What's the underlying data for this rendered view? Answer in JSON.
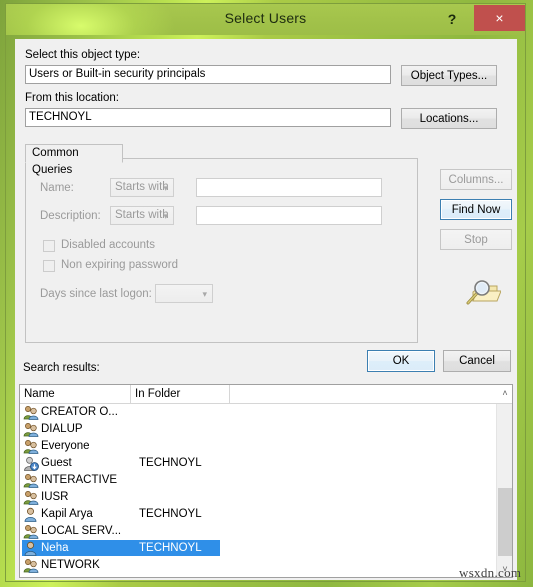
{
  "window": {
    "title": "Select Users",
    "help_label": "?",
    "close_label": "×"
  },
  "form": {
    "object_type_label": "Select this object type:",
    "object_type_value": "Users or Built-in security principals",
    "object_types_button": "Object Types...",
    "location_label": "From this location:",
    "location_value": "TECHNOYL",
    "locations_button": "Locations..."
  },
  "common_queries": {
    "tab_label": "Common Queries",
    "name_label": "Name:",
    "name_operator": "Starts with",
    "name_value": "",
    "description_label": "Description:",
    "description_operator": "Starts with",
    "description_value": "",
    "disabled_accounts_label": "Disabled accounts",
    "non_expiring_password_label": "Non expiring password",
    "days_since_logon_label": "Days since last logon:",
    "days_since_logon_value": ""
  },
  "side_buttons": {
    "columns": "Columns...",
    "find_now": "Find Now",
    "stop": "Stop"
  },
  "footer": {
    "ok": "OK",
    "cancel": "Cancel",
    "search_results_label": "Search results:"
  },
  "results": {
    "columns": [
      "Name",
      "In Folder",
      ""
    ],
    "rows": [
      {
        "name": "CREATOR O...",
        "folder": "",
        "icon": "group-icon",
        "selected": false
      },
      {
        "name": "DIALUP",
        "folder": "",
        "icon": "group-icon",
        "selected": false
      },
      {
        "name": "Everyone",
        "folder": "",
        "icon": "group-icon",
        "selected": false
      },
      {
        "name": "Guest",
        "folder": "TECHNOYL",
        "icon": "user-disabled-icon",
        "selected": false
      },
      {
        "name": "INTERACTIVE",
        "folder": "",
        "icon": "group-icon",
        "selected": false
      },
      {
        "name": "IUSR",
        "folder": "",
        "icon": "group-icon",
        "selected": false
      },
      {
        "name": "Kapil Arya",
        "folder": "TECHNOYL",
        "icon": "user-icon",
        "selected": false
      },
      {
        "name": "LOCAL SERV...",
        "folder": "",
        "icon": "group-icon",
        "selected": false
      },
      {
        "name": "Neha",
        "folder": "TECHNOYL",
        "icon": "user-icon",
        "selected": true
      },
      {
        "name": "NETWORK",
        "folder": "",
        "icon": "group-icon",
        "selected": false
      }
    ]
  },
  "scrollbar": {
    "up_arrow": "˄",
    "down_arrow": "˅"
  },
  "watermark": "wsxdn.com",
  "colors": {
    "title_green": "#a2c24a",
    "close_red": "#c0504d",
    "selection_blue": "#2f8fe8",
    "default_button_border": "#3c7fb1",
    "dialog_bg": "#f0f0f0"
  }
}
